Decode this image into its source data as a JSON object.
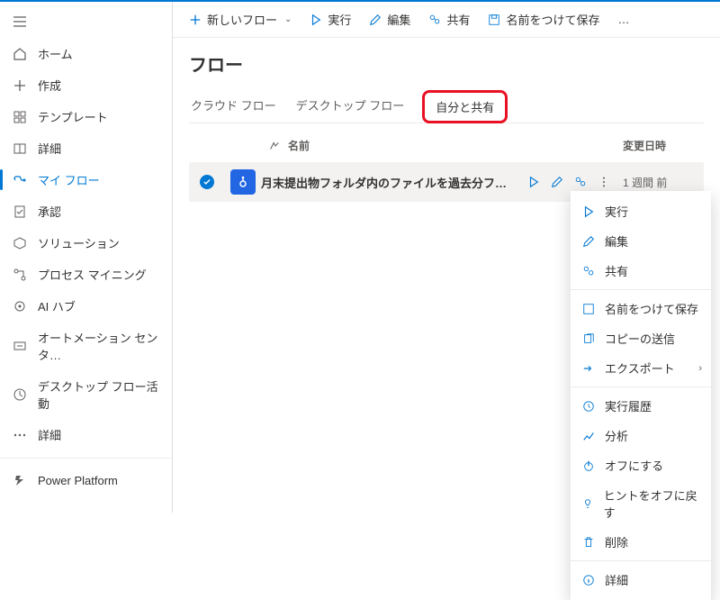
{
  "toolbar": {
    "new_flow": "新しいフロー",
    "run": "実行",
    "edit": "編集",
    "share": "共有",
    "save_as": "名前をつけて保存",
    "more": "…"
  },
  "page_title": "フロー",
  "tabs": {
    "cloud": "クラウド フロー",
    "desktop": "デスクトップ フロー",
    "shared": "自分と共有"
  },
  "cols": {
    "name": "名前",
    "modified": "変更日時"
  },
  "row": {
    "name": "月末提出物フォルダ内のファイルを過去分フォ…",
    "modified": "1 週間 前"
  },
  "menu": {
    "run": "実行",
    "edit": "編集",
    "share": "共有",
    "save_as": "名前をつけて保存",
    "send_copy": "コピーの送信",
    "export": "エクスポート",
    "history": "実行履歴",
    "analytics": "分析",
    "turn_off": "オフにする",
    "hints_off": "ヒントをオフに戻す",
    "delete": "削除",
    "details": "詳細"
  },
  "sidebar": {
    "home": "ホーム",
    "create": "作成",
    "templates": "テンプレート",
    "learn": "詳細",
    "my_flows": "マイ フロー",
    "approvals": "承認",
    "solutions": "ソリューション",
    "process": "プロセス マイニング",
    "ai_hub": "AI ハブ",
    "automation_center": "オートメーション センタ…",
    "desktop_activity": "デスクトップ フロー活動",
    "more": "詳細",
    "power_platform": "Power Platform"
  }
}
